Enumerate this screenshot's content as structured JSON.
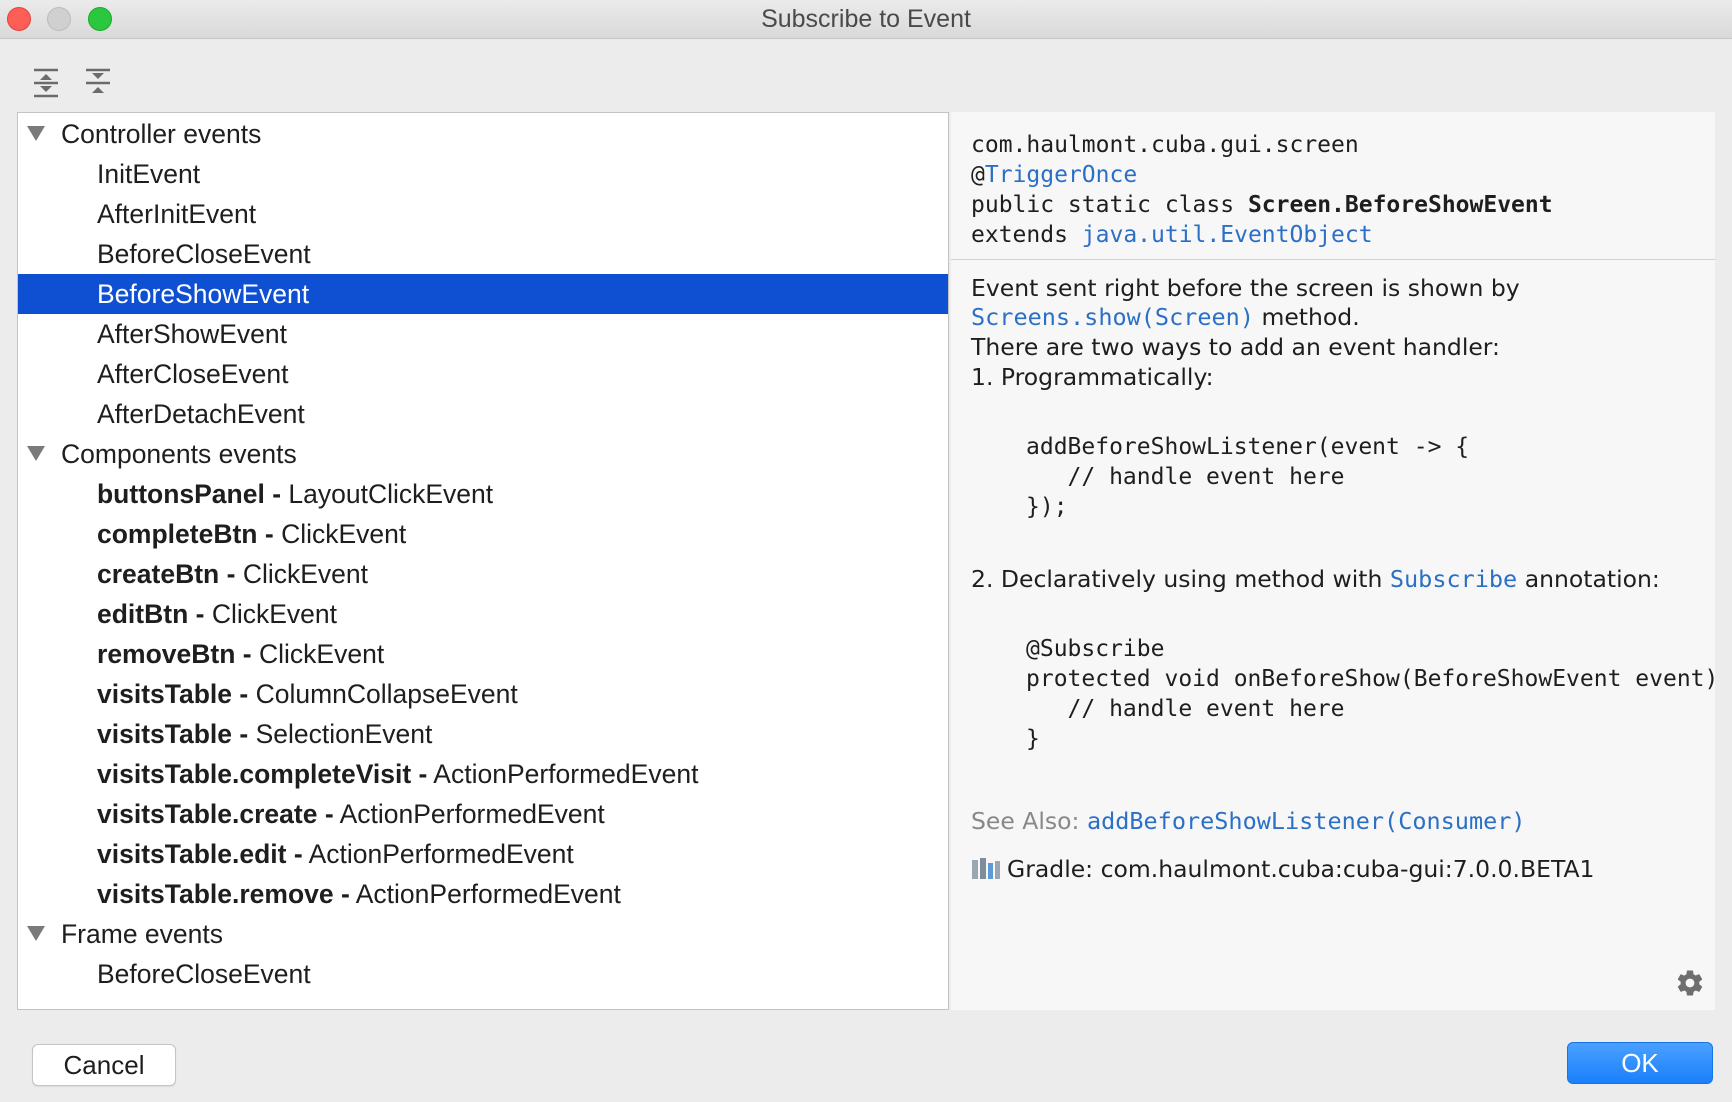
{
  "window": {
    "title": "Subscribe to Event"
  },
  "toolbar": {
    "expand_all_icon": "expand-all-icon",
    "collapse_all_icon": "collapse-all-icon"
  },
  "tree": {
    "groups": [
      {
        "label": "Controller events",
        "items": [
          "InitEvent",
          "AfterInitEvent",
          "BeforeCloseEvent",
          "BeforeShowEvent",
          "AfterShowEvent",
          "AfterCloseEvent",
          "AfterDetachEvent"
        ]
      },
      {
        "label": "Components events",
        "items": [
          {
            "source": "buttonsPanel -",
            "event": "LayoutClickEvent"
          },
          {
            "source": "completeBtn -",
            "event": "ClickEvent"
          },
          {
            "source": "createBtn -",
            "event": "ClickEvent"
          },
          {
            "source": "editBtn -",
            "event": "ClickEvent"
          },
          {
            "source": "removeBtn -",
            "event": "ClickEvent"
          },
          {
            "source": "visitsTable -",
            "event": "ColumnCollapseEvent"
          },
          {
            "source": "visitsTable -",
            "event": "SelectionEvent"
          },
          {
            "source": "visitsTable.completeVisit -",
            "event": "ActionPerformedEvent"
          },
          {
            "source": "visitsTable.create -",
            "event": "ActionPerformedEvent"
          },
          {
            "source": "visitsTable.edit -",
            "event": "ActionPerformedEvent"
          },
          {
            "source": "visitsTable.remove -",
            "event": "ActionPerformedEvent"
          }
        ]
      },
      {
        "label": "Frame events",
        "items": [
          "BeforeCloseEvent"
        ]
      }
    ],
    "selected": "BeforeShowEvent"
  },
  "doc": {
    "package": "com.haulmont.cuba.gui.screen",
    "annotation_prefix": "@",
    "annotation_name": "TriggerOnce",
    "declaration_prefix": "public static class ",
    "class_name": "Screen.BeforeShowEvent",
    "extends_prefix": "extends ",
    "extends_class": "java.util.EventObject",
    "description_1": "Event sent right before the screen is shown by",
    "description_link": "Screens.show(Screen)",
    "description_2": " method.",
    "description_3": "There are two ways to add an event handler:",
    "step_1": "1. Programmatically:",
    "code_1": [
      "addBeforeShowListener(event -> {",
      "   // handle event here",
      "});"
    ],
    "step_2_prefix": "2. Declaratively using method with ",
    "step_2_link": "Subscribe",
    "step_2_suffix": " annotation:",
    "code_2": [
      "@Subscribe",
      "protected void onBeforeShow(BeforeShowEvent event)",
      "   // handle event here",
      "}"
    ],
    "see_also_label": "See Also:",
    "see_also_link": "addBeforeShowListener(Consumer)",
    "library": "Gradle: com.haulmont.cuba:cuba-gui:7.0.0.BETA1",
    "settings_icon": "gear-icon"
  },
  "buttons": {
    "cancel": "Cancel",
    "ok": "OK"
  },
  "colors": {
    "selection": "#0f50d3",
    "link": "#2b6fc6",
    "ok_button": "#1a80fb",
    "close": "#fd5f57",
    "maximize": "#2ac73f"
  }
}
